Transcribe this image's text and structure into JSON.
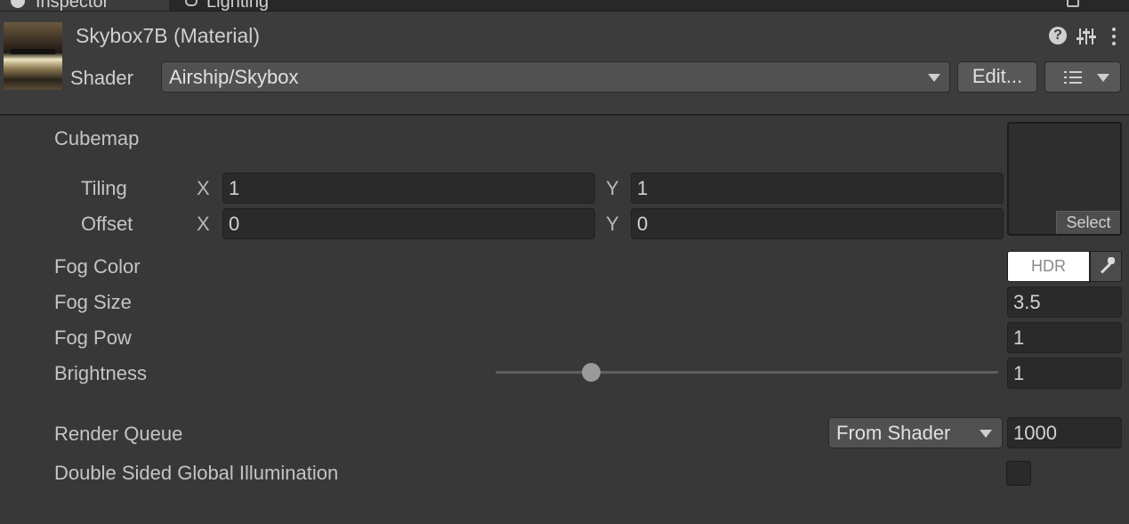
{
  "tabs": [
    {
      "label": "Inspector",
      "active": true
    },
    {
      "label": "Lighting",
      "active": false
    }
  ],
  "header": {
    "material_title": "Skybox7B (Material)",
    "help_glyph": "?",
    "shader_label": "Shader",
    "shader_value": "Airship/Skybox",
    "edit_button": "Edit...",
    "icons": [
      "help-icon",
      "presets-icon",
      "more-menu-icon",
      "list-icon",
      "chevron-down-icon"
    ]
  },
  "properties": {
    "cubemap_label": "Cubemap",
    "tiling": {
      "label": "Tiling",
      "x_axis": "X",
      "x": "1",
      "y_axis": "Y",
      "y": "1"
    },
    "offset": {
      "label": "Offset",
      "x_axis": "X",
      "x": "0",
      "y_axis": "Y",
      "y": "0"
    },
    "texture_select": "Select",
    "fog_color": {
      "label": "Fog Color",
      "field_text": "HDR",
      "color": "#ffffff"
    },
    "fog_size": {
      "label": "Fog Size",
      "value": "3.5"
    },
    "fog_pow": {
      "label": "Fog Pow",
      "value": "1"
    },
    "brightness": {
      "label": "Brightness",
      "value": "1",
      "slider_fraction": 0.19
    }
  },
  "advanced": {
    "render_queue": {
      "label": "Render Queue",
      "mode": "From Shader",
      "value": "1000"
    },
    "double_sided_gi": {
      "label": "Double Sided Global Illumination",
      "checked": false
    }
  },
  "colors": {
    "panel_bg": "#383838",
    "header_bg": "#3c3c3c",
    "field_bg": "#2a2a2a",
    "text": "#c4c4c4"
  }
}
